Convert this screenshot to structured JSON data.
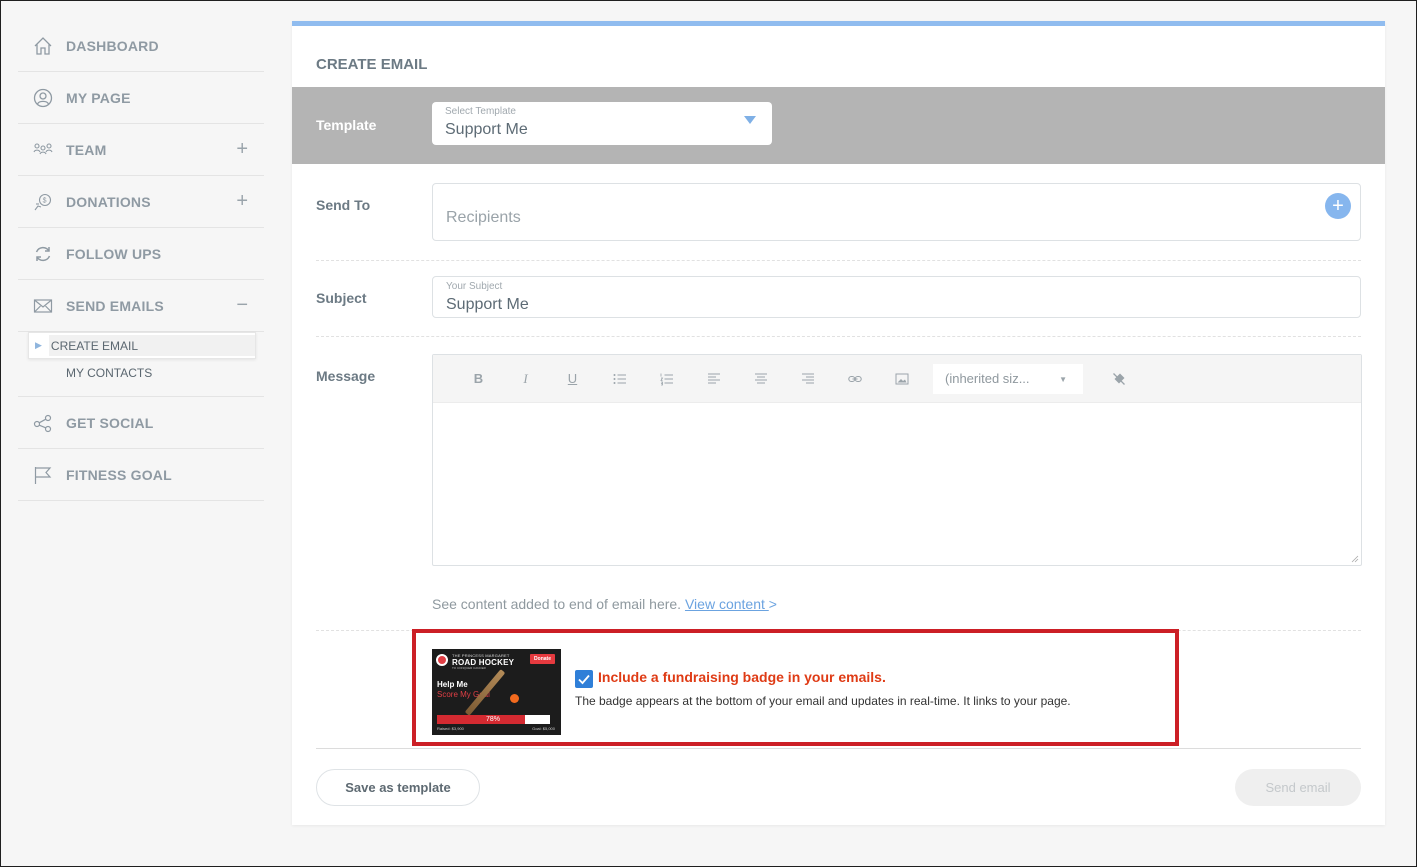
{
  "sidebar": {
    "items": [
      {
        "label": "DASHBOARD",
        "icon": "home-icon"
      },
      {
        "label": "MY PAGE",
        "icon": "user-circle-icon"
      },
      {
        "label": "TEAM",
        "icon": "team-icon",
        "toggle": "+"
      },
      {
        "label": "DONATIONS",
        "icon": "money-hand-icon",
        "toggle": "+"
      },
      {
        "label": "FOLLOW UPS",
        "icon": "refresh-icon"
      },
      {
        "label": "SEND EMAILS",
        "icon": "envelope-icon",
        "toggle": "−"
      },
      {
        "label": "GET SOCIAL",
        "icon": "share-icon"
      },
      {
        "label": "FITNESS GOAL",
        "icon": "flag-icon"
      }
    ],
    "sub_items": [
      {
        "label": "CREATE EMAIL",
        "active": true
      },
      {
        "label": "MY CONTACTS",
        "active": false
      }
    ]
  },
  "main": {
    "title": "CREATE EMAIL",
    "template": {
      "label": "Template",
      "small_label": "Select Template",
      "value": "Support Me"
    },
    "send_to": {
      "label": "Send To",
      "placeholder": "Recipients",
      "add_symbol": "+"
    },
    "subject": {
      "label": "Subject",
      "small_label": "Your Subject",
      "value": "Support Me"
    },
    "message": {
      "label": "Message",
      "toolbar": {
        "bold": "B",
        "italic": "I",
        "underline": "U",
        "font_size": "(inherited siz..."
      }
    },
    "see_content": {
      "text": "See content added to end of email here.",
      "link": "View content ",
      "suffix": ">"
    },
    "badge": {
      "checked": true,
      "heading": "Include a fundraising badge in your emails.",
      "description": "The badge appears at the bottom of your email and updates in real-time. It links to your page.",
      "image": {
        "small_text": "THE PRINCESS MARGARET",
        "brand": "ROAD HOCKEY",
        "tagline": "TO CONQUER CANCER",
        "donate": "Donate",
        "help": "Help Me",
        "score": "Score My Goal",
        "progress": 0.78,
        "percent": "78%",
        "raised": "Raised: $3,900",
        "goal": "Goal: $5,000"
      }
    },
    "buttons": {
      "save_template": "Save as template",
      "send_email": "Send email"
    }
  },
  "colors": {
    "accent_blue": "#90bcef",
    "highlight_red": "#cc1f26",
    "badge_heading": "#df3b15",
    "checkbox": "#2f7fd8"
  }
}
